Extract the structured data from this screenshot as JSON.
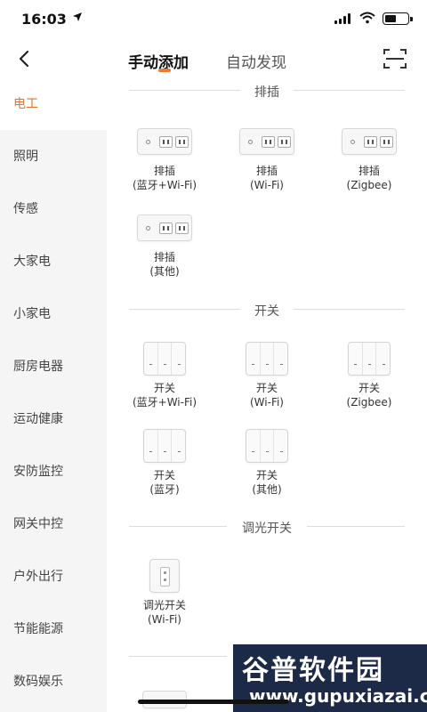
{
  "status_bar": {
    "time": "16:03",
    "location_icon": "location-arrow-icon",
    "signal_icon": "signal-icon",
    "wifi_icon": "wifi-icon",
    "battery_level": 0.45
  },
  "header": {
    "tabs": [
      {
        "label": "手动添加",
        "active": true
      },
      {
        "label": "自动发现",
        "active": false
      }
    ],
    "back_icon": "chevron-left-icon",
    "scan_icon": "scan-icon",
    "accent_color": "#f07b2a"
  },
  "sidebar": {
    "items": [
      {
        "label": "电工",
        "active": true
      },
      {
        "label": "照明",
        "active": false
      },
      {
        "label": "传感",
        "active": false
      },
      {
        "label": "大家电",
        "active": false
      },
      {
        "label": "小家电",
        "active": false
      },
      {
        "label": "厨房电器",
        "active": false
      },
      {
        "label": "运动健康",
        "active": false
      },
      {
        "label": "安防监控",
        "active": false
      },
      {
        "label": "网关中控",
        "active": false
      },
      {
        "label": "户外出行",
        "active": false
      },
      {
        "label": "节能能源",
        "active": false
      },
      {
        "label": "数码娱乐",
        "active": false
      }
    ]
  },
  "sections": [
    {
      "title": "排插",
      "items": [
        {
          "name": "排插",
          "protocol": "(蓝牙+Wi-Fi)",
          "icon": "power-strip-icon"
        },
        {
          "name": "排插",
          "protocol": "(Wi-Fi)",
          "icon": "power-strip-icon"
        },
        {
          "name": "排插",
          "protocol": "(Zigbee)",
          "icon": "power-strip-icon"
        },
        {
          "name": "排插",
          "protocol": "(其他)",
          "icon": "power-strip-icon"
        }
      ]
    },
    {
      "title": "开关",
      "items": [
        {
          "name": "开关",
          "protocol": "(蓝牙+Wi-Fi)",
          "icon": "wall-switch-icon"
        },
        {
          "name": "开关",
          "protocol": "(Wi-Fi)",
          "icon": "wall-switch-icon"
        },
        {
          "name": "开关",
          "protocol": "(Zigbee)",
          "icon": "wall-switch-icon"
        },
        {
          "name": "开关",
          "protocol": "(蓝牙)",
          "icon": "wall-switch-icon"
        },
        {
          "name": "开关",
          "protocol": "(其他)",
          "icon": "wall-switch-icon"
        }
      ]
    },
    {
      "title": "调光开关",
      "items": [
        {
          "name": "调光开关",
          "protocol": "(Wi-Fi)",
          "icon": "dimmer-switch-icon"
        }
      ]
    }
  ],
  "watermark": {
    "line1": "谷普软件园",
    "line2": "www.gupuxiazai.com"
  }
}
